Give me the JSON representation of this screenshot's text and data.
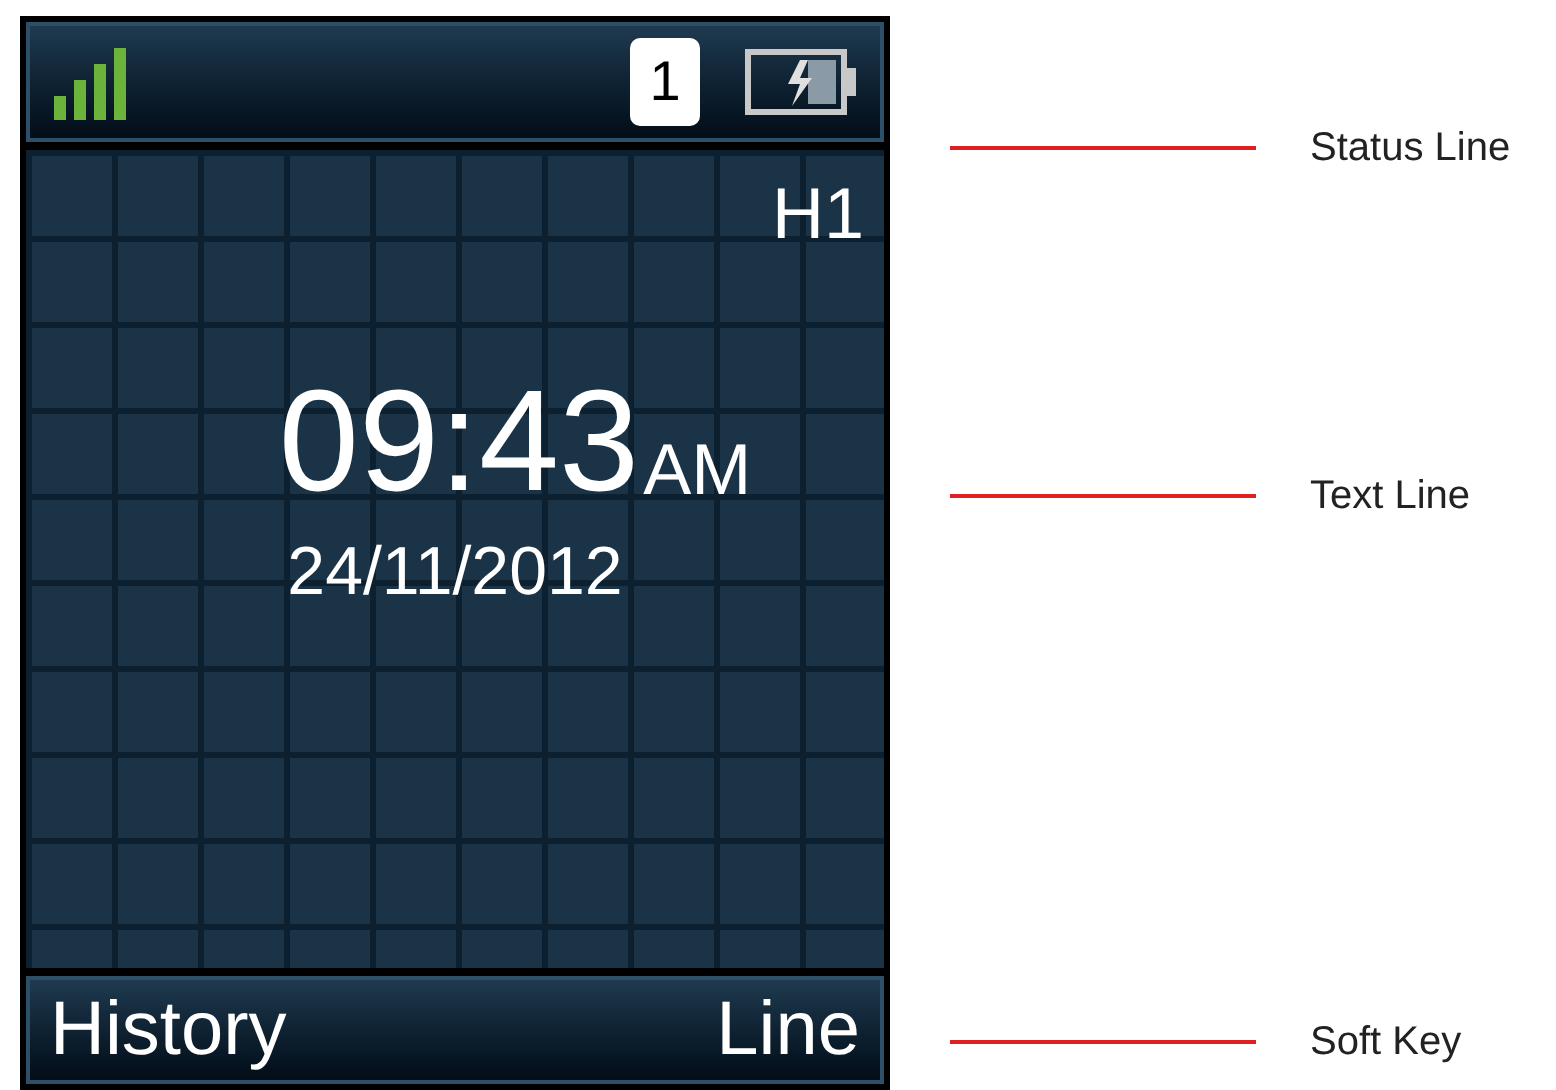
{
  "status_line": {
    "line_number": "1"
  },
  "home_screen": {
    "handset": "H1",
    "time": "09:43",
    "meridiem": "AM",
    "date": "24/11/2012"
  },
  "soft_keys": [
    {
      "label": "History"
    },
    {
      "label": "Line"
    }
  ],
  "annotations": [
    {
      "label": "Status Line"
    },
    {
      "label": "Text Line"
    },
    {
      "label": "Soft Key"
    }
  ]
}
